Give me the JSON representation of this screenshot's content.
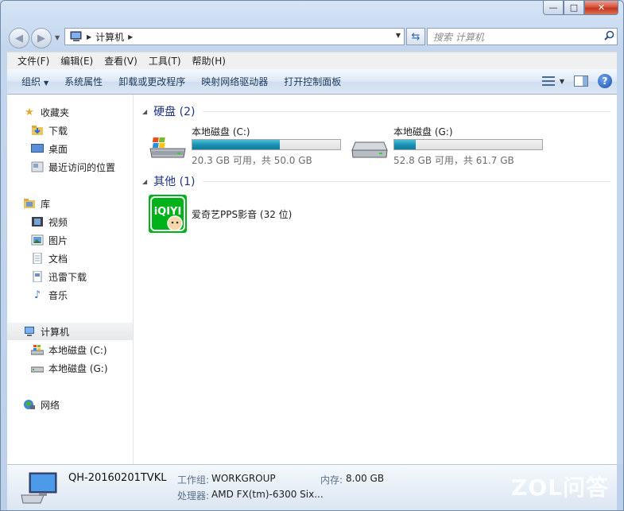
{
  "window": {
    "caption_min": "—",
    "caption_max": "□",
    "caption_close": "✕"
  },
  "address": {
    "crumb": "计算机"
  },
  "search": {
    "placeholder": "搜索 计算机"
  },
  "menu": [
    "文件(F)",
    "编辑(E)",
    "查看(V)",
    "工具(T)",
    "帮助(H)"
  ],
  "toolbar": {
    "organize": "组织",
    "system_properties": "系统属性",
    "uninstall": "卸载或更改程序",
    "map_drive": "映射网络驱动器",
    "control_panel": "打开控制面板"
  },
  "sidebar": {
    "favorites": "收藏夹",
    "downloads": "下载",
    "desktop": "桌面",
    "recent": "最近访问的位置",
    "libraries": "库",
    "videos": "视频",
    "pictures": "图片",
    "documents": "文档",
    "thunder": "迅雷下载",
    "music": "音乐",
    "computer": "计算机",
    "drive_c": "本地磁盘 (C:)",
    "drive_g": "本地磁盘 (G:)",
    "network": "网络"
  },
  "groups": {
    "hard_disks": "硬盘 (2)",
    "other": "其他 (1)"
  },
  "drives": [
    {
      "name": "本地磁盘 (C:)",
      "free_text": "20.3 GB 可用，共 50.0 GB",
      "used_fraction": 0.594
    },
    {
      "name": "本地磁盘 (G:)",
      "free_text": "52.8 GB 可用，共 61.7 GB",
      "used_fraction": 0.144
    }
  ],
  "other_items": [
    {
      "name": "爱奇艺PPS影音 (32 位)",
      "logo_text": "iQIYI"
    }
  ],
  "details": {
    "computer_name": "QH-20160201TVKL",
    "workgroup_label": "工作组:",
    "workgroup_value": "WORKGROUP",
    "memory_label": "内存:",
    "memory_value": "8.00 GB",
    "cpu_label": "处理器:",
    "cpu_value": "AMD FX(tm)-6300 Six..."
  },
  "watermark": "ZOL问答"
}
